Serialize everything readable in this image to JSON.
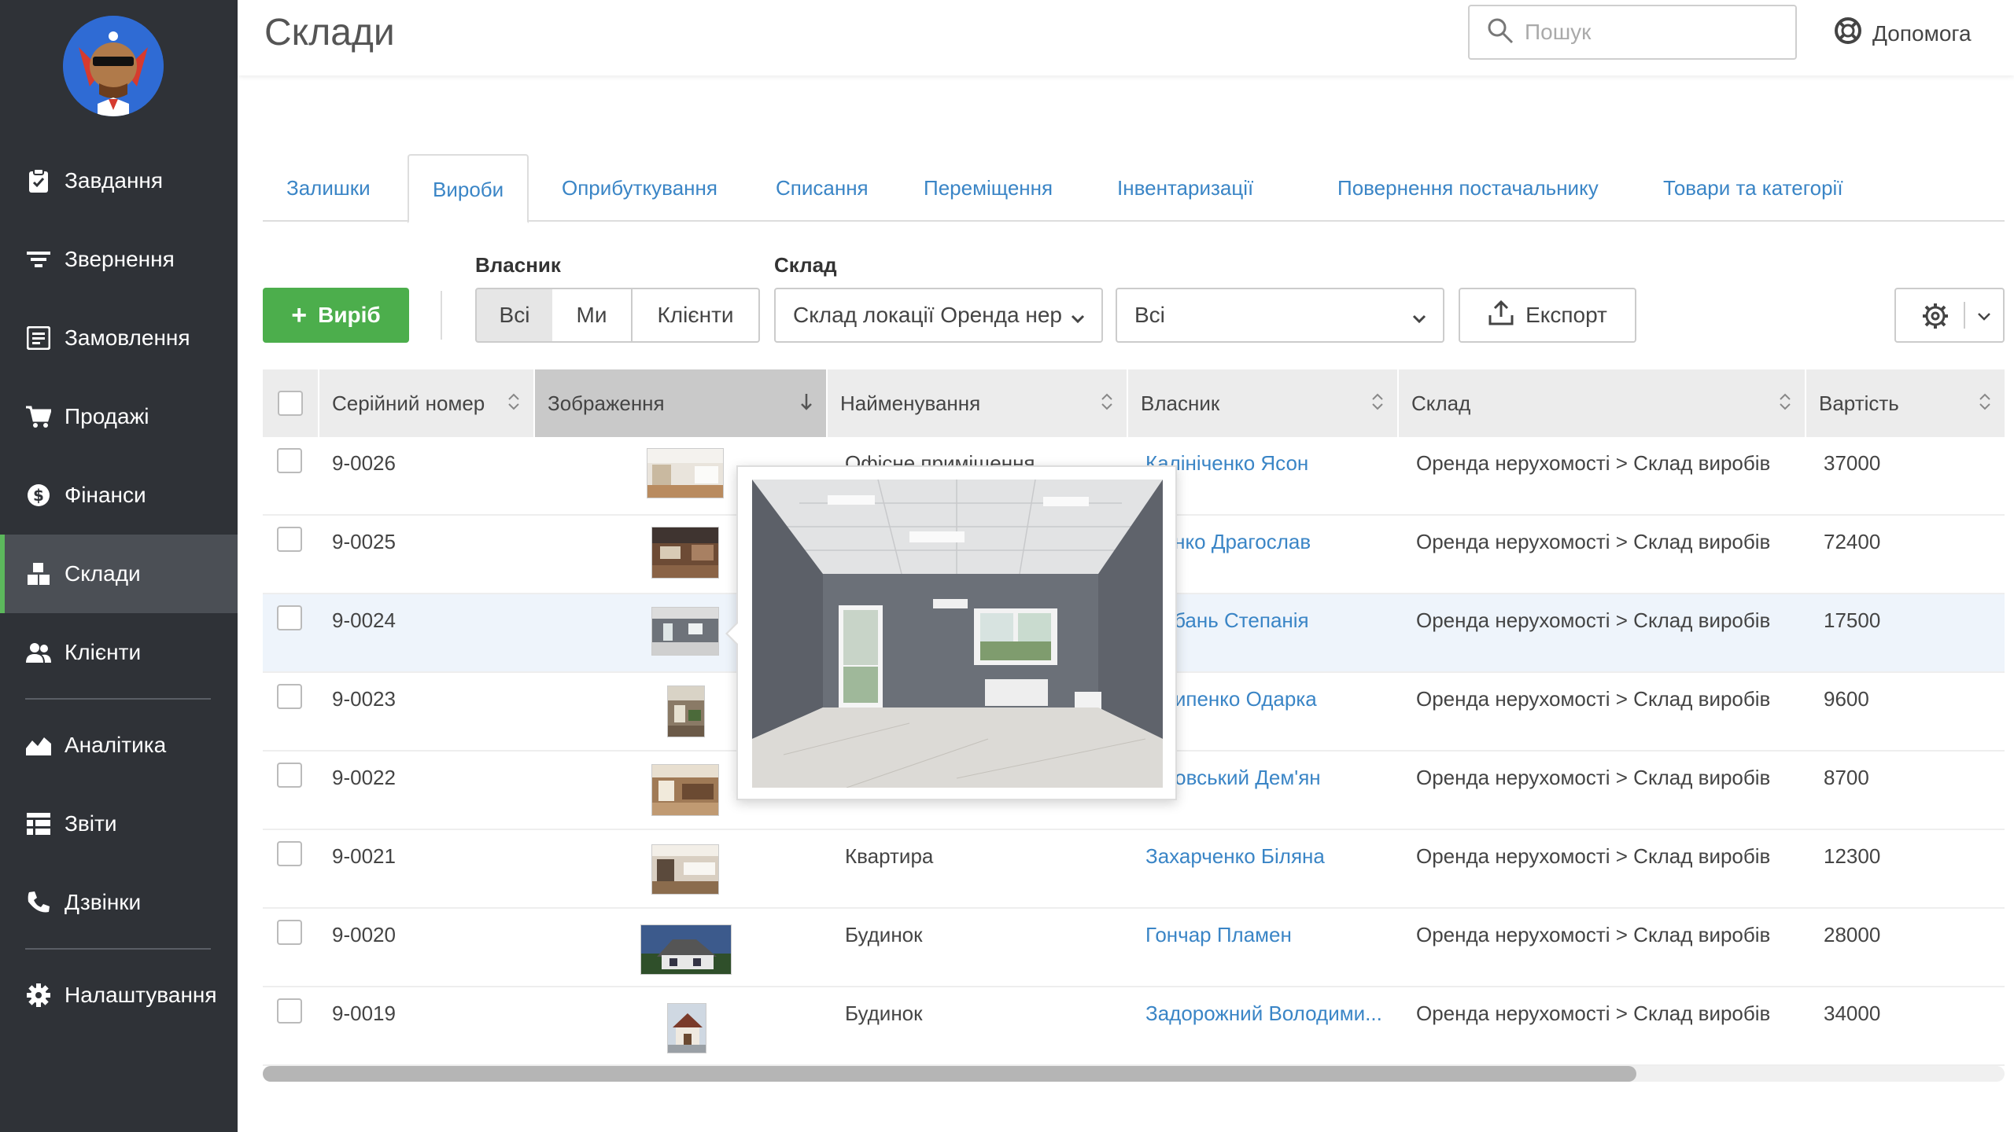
{
  "sidebar": {
    "items": [
      {
        "label": "Завдання",
        "icon": "clipboard-check-icon"
      },
      {
        "label": "Звернення",
        "icon": "filter-lines-icon"
      },
      {
        "label": "Замовлення",
        "icon": "list-box-icon"
      },
      {
        "label": "Продажі",
        "icon": "cart-icon"
      },
      {
        "label": "Фінанси",
        "icon": "dollar-circle-icon"
      },
      {
        "label": "Склади",
        "icon": "boxes-icon",
        "active": true
      },
      {
        "label": "Клієнти",
        "icon": "users-icon"
      },
      {
        "label": "Аналітика",
        "icon": "area-chart-icon"
      },
      {
        "label": "Звіти",
        "icon": "table-report-icon"
      },
      {
        "label": "Дзвінки",
        "icon": "phone-icon"
      },
      {
        "label": "Налаштування",
        "icon": "gear-icon"
      }
    ]
  },
  "header": {
    "title": "Склади",
    "search_placeholder": "Пошук",
    "help_label": "Допомога"
  },
  "tabs": [
    {
      "label": "Залишки"
    },
    {
      "label": "Вироби",
      "active": true
    },
    {
      "label": "Оприбуткування"
    },
    {
      "label": "Списання"
    },
    {
      "label": "Переміщення"
    },
    {
      "label": "Інвентаризації"
    },
    {
      "label": "Повернення постачальнику"
    },
    {
      "label": "Товари та категорії"
    }
  ],
  "toolbar": {
    "add_label": "Виріб",
    "owner_label": "Власник",
    "owner_options": [
      "Всі",
      "Ми",
      "Клієнти"
    ],
    "owner_selected": "Всі",
    "warehouse_label": "Склад",
    "warehouse_value": "Склад локації Оренда нер",
    "filter_value": "Всі",
    "export_label": "Експорт"
  },
  "table": {
    "columns": [
      "Серійний номер",
      "Зображення",
      "Найменування",
      "Власник",
      "Склад",
      "Вартість"
    ],
    "sorted_column": "Зображення",
    "rows": [
      {
        "serial": "9-0026",
        "name": "Офісне приміщення",
        "owner": "Калініченко Ясон",
        "warehouse": "Оренда нерухомості > Склад виробів",
        "price": "37000"
      },
      {
        "serial": "9-0025",
        "name": "",
        "owner": "...енко Драгослав",
        "warehouse": "Оренда нерухомості > Склад виробів",
        "price": "72400"
      },
      {
        "serial": "9-0024",
        "name": "",
        "owner": "...рбань Степанія",
        "warehouse": "Оренда нерухомості > Склад виробів",
        "price": "17500"
      },
      {
        "serial": "9-0023",
        "name": "",
        "owner": "...липенко Одарка",
        "warehouse": "Оренда нерухомості > Склад виробів",
        "price": "9600"
      },
      {
        "serial": "9-0022",
        "name": "",
        "owner": "...ловський Дем'ян",
        "warehouse": "Оренда нерухомості > Склад виробів",
        "price": "8700"
      },
      {
        "serial": "9-0021",
        "name": "Квартира",
        "owner": "Захарченко Біляна",
        "warehouse": "Оренда нерухомості > Склад виробів",
        "price": "12300"
      },
      {
        "serial": "9-0020",
        "name": "Будинок",
        "owner": "Гончар Пламен",
        "warehouse": "Оренда нерухомості > Склад виробів",
        "price": "28000"
      },
      {
        "serial": "9-0019",
        "name": "Будинок",
        "owner": "Задорожний Володими...",
        "warehouse": "Оренда нерухомості > Склад виробів",
        "price": "34000"
      }
    ]
  },
  "colors": {
    "sidebar_bg": "#2f3237",
    "sidebar_active": "#4b4f55",
    "accent_green": "#4cae4c",
    "link_blue": "#3a85c6"
  }
}
